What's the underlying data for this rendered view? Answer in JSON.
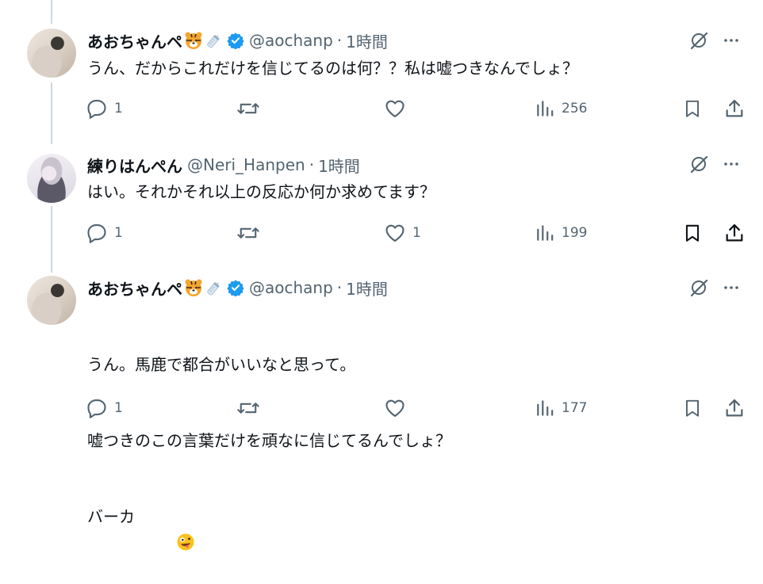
{
  "tweets": [
    {
      "display_name": "あおちゃんペ",
      "emojis": [
        "tiger-face",
        "baby-bottle"
      ],
      "verified": true,
      "handle": "@aochanp",
      "time": "1時間",
      "text": "うん、だからこれだけを信じてるのは何？？私は嘘つきなんでしょ？",
      "replies": "1",
      "retweets": "",
      "likes": "",
      "views": "256",
      "bookmarked": false
    },
    {
      "display_name": "練りはんぺん",
      "emojis": [],
      "verified": false,
      "handle": "@Neri_Hanpen",
      "time": "1時間",
      "text": "はい。それかそれ以上の反応か何か求めてます？",
      "replies": "1",
      "retweets": "",
      "likes": "1",
      "views": "199",
      "bookmarked": true
    },
    {
      "display_name": "あおちゃんペ",
      "emojis": [
        "tiger-face",
        "baby-bottle"
      ],
      "verified": true,
      "handle": "@aochanp",
      "time": "1時間",
      "text_lines": [
        "うん。馬鹿で都合がいいなと思って。",
        "嘘つきのこの言葉だけを頑なに信じてるんでしょ？",
        "バーカ"
      ],
      "text_trailing_emoji": "zany-face",
      "replies": "1",
      "retweets": "",
      "likes": "",
      "views": "177",
      "bookmarked": false
    }
  ],
  "separator": "·",
  "colors": {
    "text": "#0f1419",
    "secondary": "#536471",
    "verified": "#1d9bf0",
    "thread_line": "#cfd9de"
  }
}
